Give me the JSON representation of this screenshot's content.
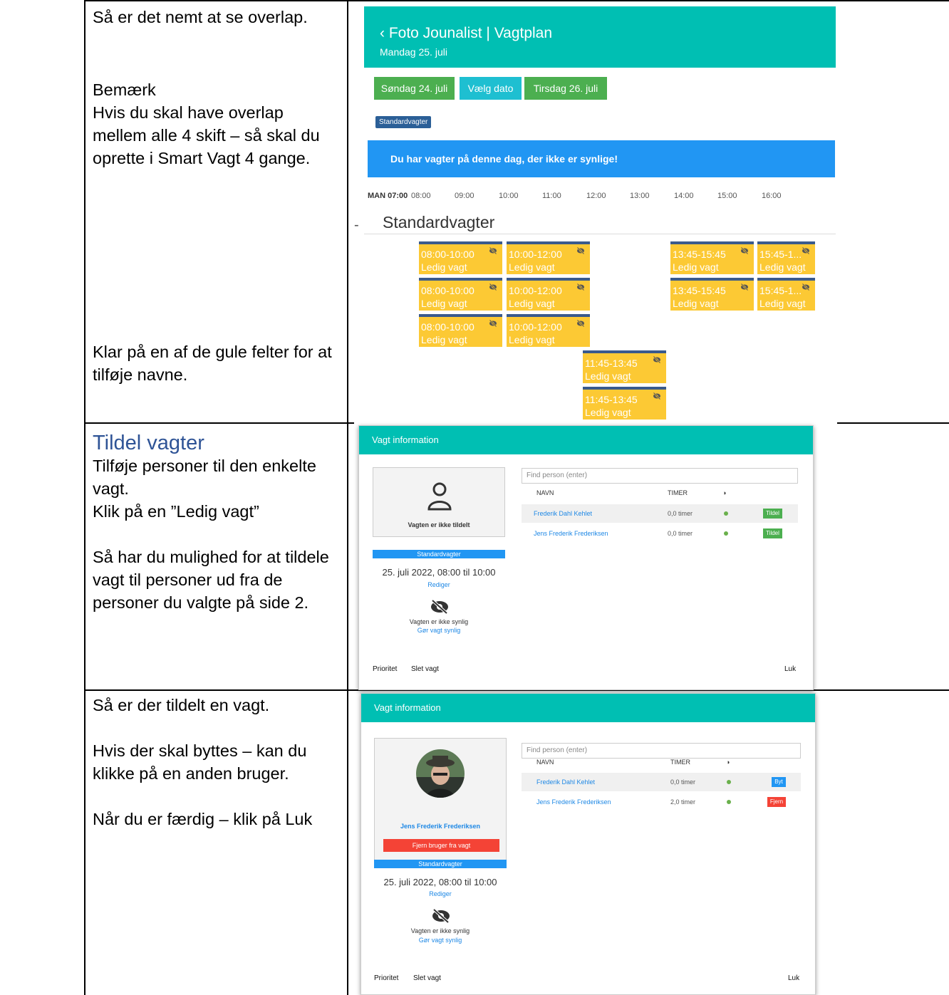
{
  "rows": [
    {
      "paragraphs": [
        "Så er det nemt at se overlap.",
        "",
        "Bemærk",
        "Hvis du skal have overlap mellem alle 4 skift – så skal du oprette i Smart Vagt 4 gange.",
        "Klar på en af de gule felter for at tilføje navne."
      ]
    },
    {
      "heading": "Tildel vagter",
      "paragraphs": [
        "Tilføje personer til den enkelte vagt.",
        "Klik på en ”Ledig vagt”",
        "Så har du mulighed for at tildele vagt til personer ud fra de personer du valgte på side 2."
      ]
    },
    {
      "paragraphs": [
        "Så er der tildelt en vagt.",
        "Hvis der skal byttes – kan du klikke på en anden bruger.",
        "Når du er færdig – klik på Luk"
      ]
    }
  ],
  "schedule": {
    "title": "‹ Foto Jounalist | Vagtplan",
    "subtitle": "Mandag 25. juli",
    "prev_day": "Søndag 24. juli",
    "pick_date": "Vælg dato",
    "next_day": "Tirsdag 26. juli",
    "tag": "Standardvagter",
    "banner": "Du har vagter på denne dag, der ikke er synlige!",
    "time_first": "MAN 07:00",
    "times": [
      "08:00",
      "09:00",
      "10:00",
      "11:00",
      "12:00",
      "13:00",
      "14:00",
      "15:00",
      "16:00"
    ],
    "group": "Standardvagter",
    "shifts": [
      {
        "time": "08:00-10:00",
        "status": "Ledig vagt"
      },
      {
        "time": "10:00-12:00",
        "status": "Ledig vagt"
      },
      {
        "time": "13:45-15:45",
        "status": "Ledig vagt"
      },
      {
        "time": "15:45-1...",
        "status": "Ledig vagt"
      },
      {
        "time": "08:00-10:00",
        "status": "Ledig vagt"
      },
      {
        "time": "10:00-12:00",
        "status": "Ledig vagt"
      },
      {
        "time": "13:45-15:45",
        "status": "Ledig vagt"
      },
      {
        "time": "15:45-1...",
        "status": "Ledig vagt"
      },
      {
        "time": "08:00-10:00",
        "status": "Ledig vagt"
      },
      {
        "time": "10:00-12:00",
        "status": "Ledig vagt"
      },
      {
        "time": "11:45-13:45",
        "status": "Ledig vagt"
      },
      {
        "time": "11:45-13:45",
        "status": "Ledig vagt"
      }
    ]
  },
  "modal1": {
    "header": "Vagt information",
    "card_text": "Vagten er ikke tildelt",
    "tag": "Standardvagter",
    "date": "25. juli 2022, 08:00 til 10:00",
    "edit": "Rediger",
    "hidden": "Vagten er ikke synlig",
    "make_visible": "Gør vagt synlig",
    "search_placeholder": "Find person (enter)",
    "col_name": "NAVN",
    "col_hours": "TIMER",
    "people": [
      {
        "name": "Frederik Dahl Kehlet",
        "hours": "0,0 timer",
        "action": "Tildel"
      },
      {
        "name": "Jens Frederik Frederiksen",
        "hours": "0,0 timer",
        "action": "Tildel"
      }
    ],
    "priority": "Prioritet",
    "delete": "Slet vagt",
    "close": "Luk"
  },
  "modal2": {
    "header": "Vagt information",
    "assigned_name": "Jens Frederik Frederiksen",
    "remove_user": "Fjern bruger fra vagt",
    "tag": "Standardvagter",
    "date": "25. juli 2022, 08:00 til 10:00",
    "edit": "Rediger",
    "hidden": "Vagten er ikke synlig",
    "make_visible": "Gør vagt synlig",
    "search_placeholder": "Find person (enter)",
    "col_name": "NAVN",
    "col_hours": "TIMER",
    "people": [
      {
        "name": "Frederik Dahl Kehlet",
        "hours": "0,0 timer",
        "action": "Byt"
      },
      {
        "name": "Jens Frederik Frederiksen",
        "hours": "2,0 timer",
        "action": "Fjern"
      }
    ],
    "priority": "Prioritet",
    "delete": "Slet vagt",
    "close": "Luk"
  },
  "colors": {
    "teal": "#00bfb3",
    "green": "#4caf50",
    "blue": "#2196f3",
    "yellow": "#fcc934",
    "red": "#f44336"
  }
}
